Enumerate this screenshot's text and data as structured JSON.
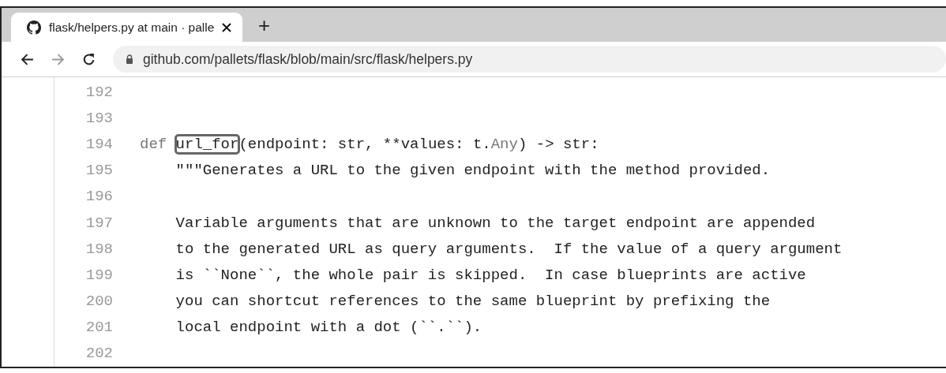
{
  "tabs": [
    {
      "title": "flask/helpers.py at main · palle",
      "selected": true
    }
  ],
  "new_tab": "+",
  "address": {
    "url": "github.com/pallets/flask/blob/main/src/flask/helpers.py"
  },
  "code": [
    {
      "number": "192"
    },
    {
      "number": "193"
    },
    {
      "number": "194",
      "tokens": [
        {
          "text": "def ",
          "kind": "keyword"
        },
        {
          "text": "url_for",
          "kind": "plain",
          "highlighted": true
        },
        {
          "text": "(endpoint: str, **values: t.",
          "kind": "plain"
        },
        {
          "text": "Any",
          "kind": "builtin"
        },
        {
          "text": ") -> str:",
          "kind": "plain"
        }
      ]
    },
    {
      "number": "195",
      "tokens": [
        {
          "text": "    \"\"\"Generates a URL to the given endpoint with the method provided.",
          "kind": "plain"
        }
      ]
    },
    {
      "number": "196"
    },
    {
      "number": "197",
      "tokens": [
        {
          "text": "    Variable arguments that are unknown to the target endpoint are appended",
          "kind": "plain"
        }
      ]
    },
    {
      "number": "198",
      "tokens": [
        {
          "text": "    to the generated URL as query arguments.  If the value of a query argument",
          "kind": "plain"
        }
      ]
    },
    {
      "number": "199",
      "tokens": [
        {
          "text": "    is ``None``, the whole pair is skipped.  In case blueprints are active",
          "kind": "plain"
        }
      ]
    },
    {
      "number": "200",
      "tokens": [
        {
          "text": "    you can shortcut references to the same blueprint by prefixing the",
          "kind": "plain"
        }
      ]
    },
    {
      "number": "201",
      "tokens": [
        {
          "text": "    local endpoint with a dot (``.``).",
          "kind": "plain"
        }
      ]
    },
    {
      "number": "202"
    }
  ]
}
